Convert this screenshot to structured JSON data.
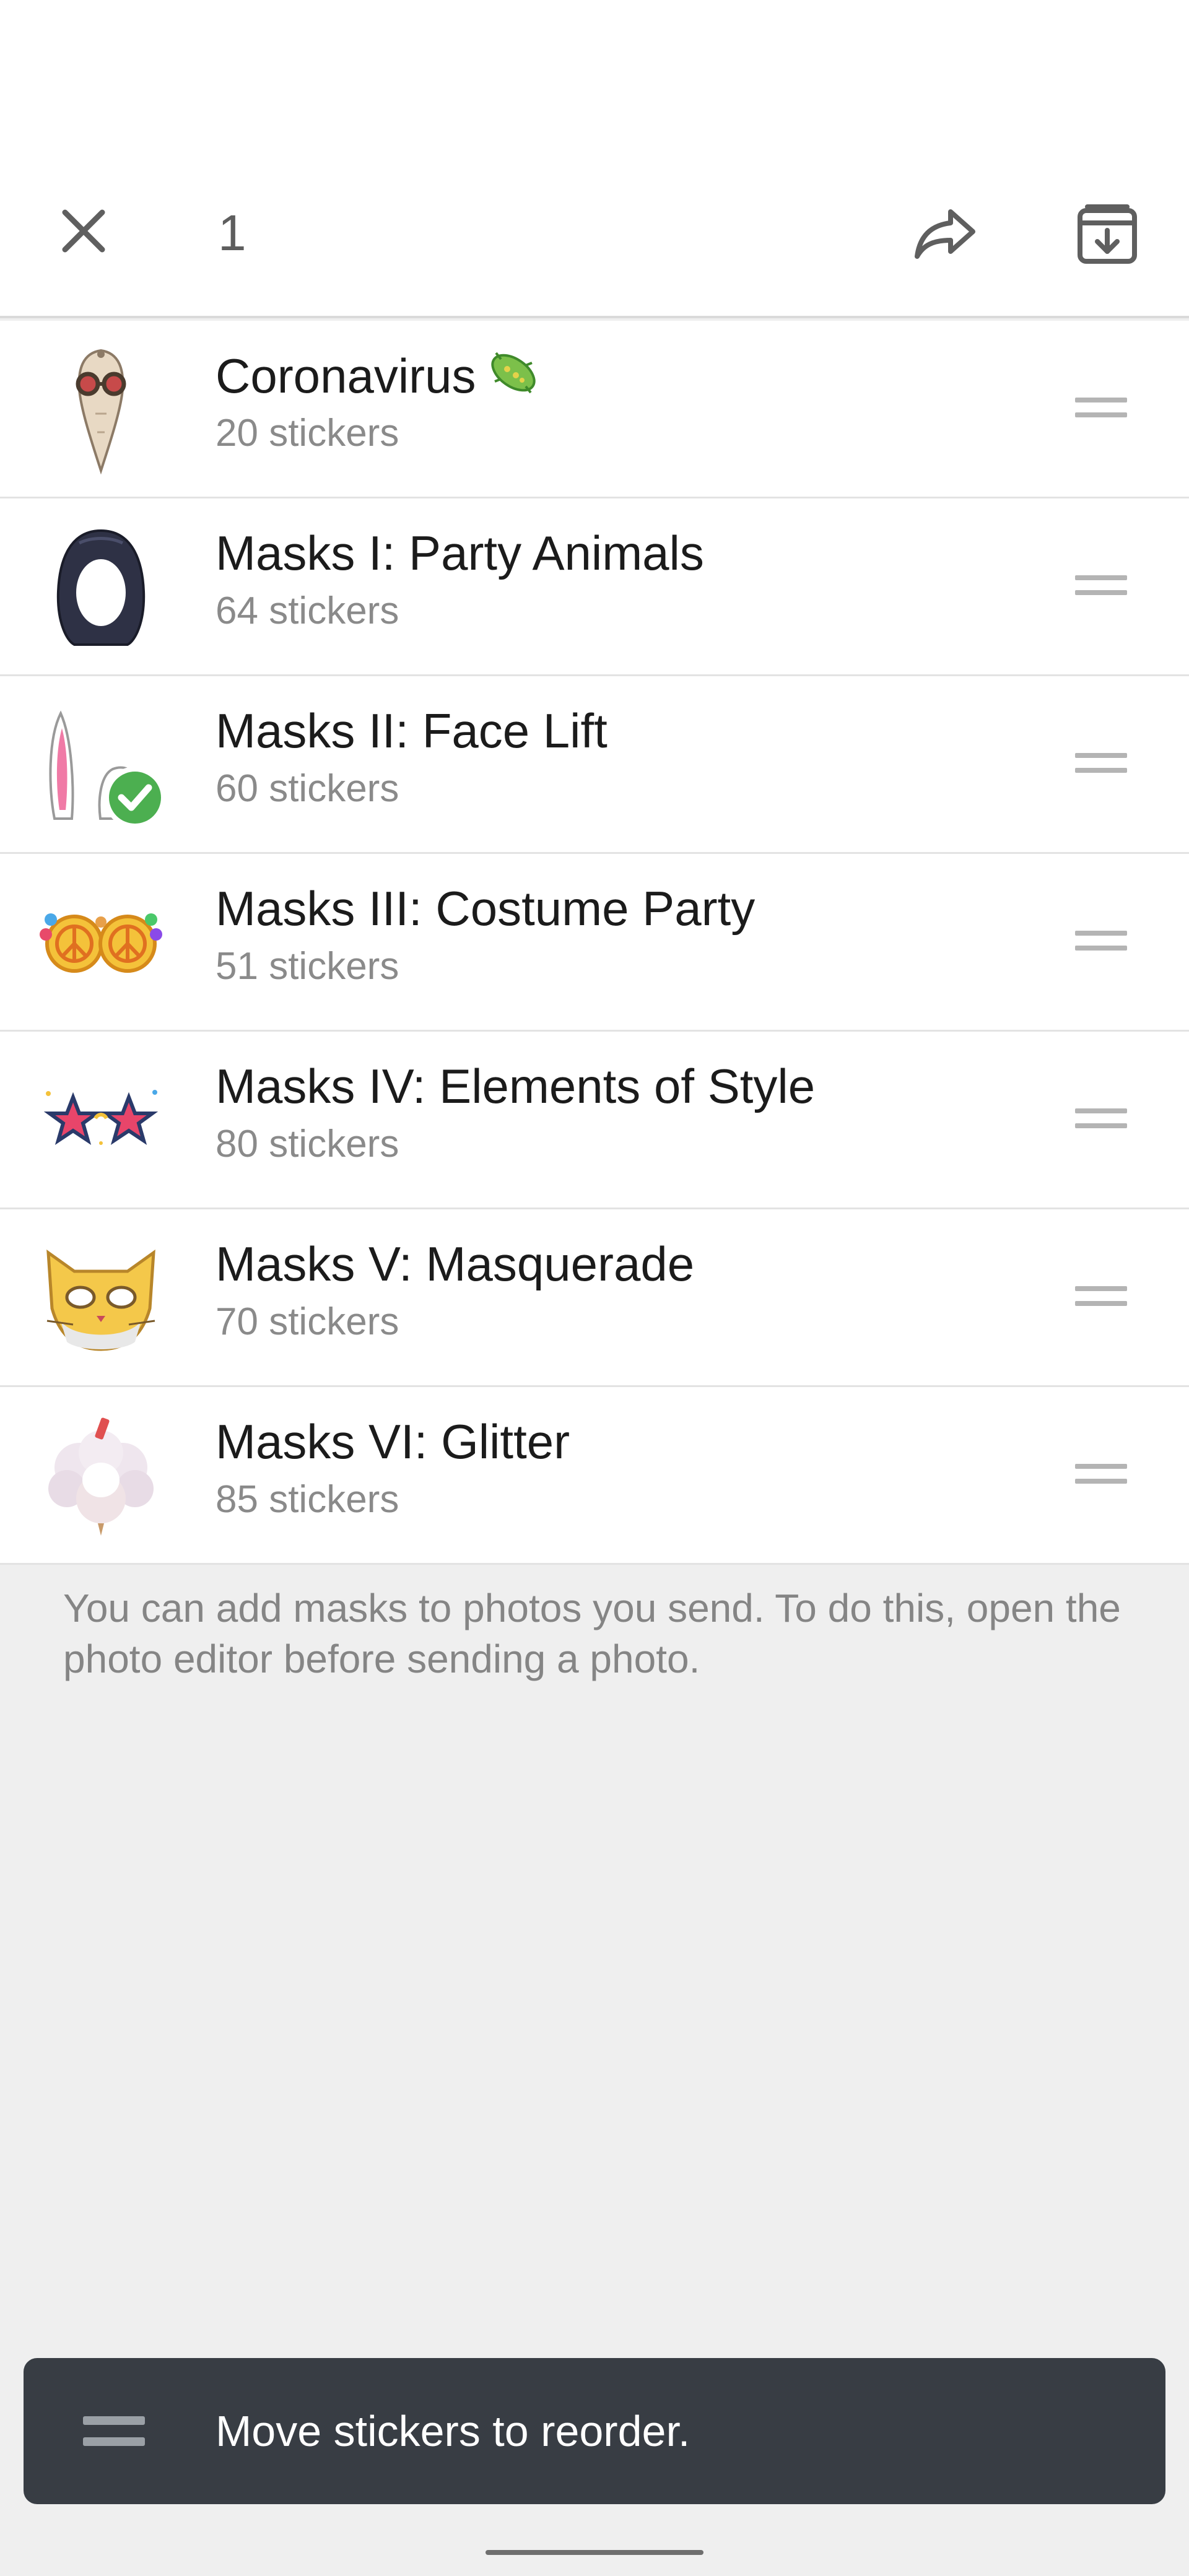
{
  "header": {
    "selected_count": "1",
    "close_icon": "close-icon",
    "share_icon": "share-icon",
    "archive_icon": "archive-icon"
  },
  "sticker_sets": [
    {
      "title": "Coronavirus",
      "subtitle": "20 stickers",
      "thumb": "plague-doctor-mask",
      "title_emoji": "microbe-emoji",
      "selected": false
    },
    {
      "title": "Masks I: Party Animals",
      "subtitle": "64 stickers",
      "thumb": "hood-mask",
      "selected": false
    },
    {
      "title": "Masks II: Face Lift",
      "subtitle": "60 stickers",
      "thumb": "bunny-ears",
      "selected": true
    },
    {
      "title": "Masks III: Costume Party",
      "subtitle": "51 stickers",
      "thumb": "peace-glasses",
      "selected": false
    },
    {
      "title": "Masks IV: Elements of Style",
      "subtitle": "80 stickers",
      "thumb": "star-glasses",
      "selected": false
    },
    {
      "title": "Masks V: Masquerade",
      "subtitle": "70 stickers",
      "thumb": "cat-mask",
      "selected": false
    },
    {
      "title": "Masks VI: Glitter",
      "subtitle": "85 stickers",
      "thumb": "cloud-mask",
      "selected": false
    }
  ],
  "hint_text": "You can add masks to photos you send. To do this, open the photo editor before sending a photo.",
  "toast": {
    "text": "Move stickers to reorder.",
    "icon": "drag-handle-icon"
  },
  "colors": {
    "background": "#efefef",
    "row_background": "#ffffff",
    "toast_background": "#383d44",
    "selected_check": "#4caf50",
    "secondary_text": "#8a8a8a"
  }
}
